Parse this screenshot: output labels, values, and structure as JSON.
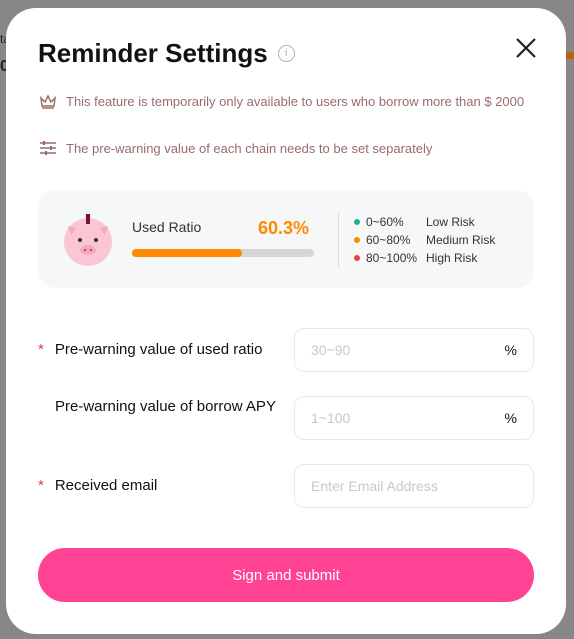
{
  "background": {
    "fragment_1": "ta",
    "fragment_2": "0"
  },
  "modal": {
    "title": "Reminder Settings",
    "notes": [
      {
        "icon": "crown-icon",
        "text": "This feature is temporarily only available to users who borrow more than $ 2000"
      },
      {
        "icon": "sliders-icon",
        "text": "The pre-warning value of each chain needs to be set separately"
      }
    ],
    "ratio_card": {
      "label": "Used Ratio",
      "value": "60.3%",
      "progress_percent": 60.3,
      "legend": [
        {
          "range": "0~60%",
          "label": "Low Risk",
          "color": "#1cb58a"
        },
        {
          "range": "60~80%",
          "label": "Medium Risk",
          "color": "#ff8a00"
        },
        {
          "range": "80~100%",
          "label": "High Risk",
          "color": "#e8453c"
        }
      ]
    },
    "fields": [
      {
        "label": "Pre-warning value of used ratio",
        "required": "*",
        "placeholder": "30~90",
        "unit": "%"
      },
      {
        "label": "Pre-warning value of borrow APY",
        "placeholder": "1~100",
        "unit": "%"
      },
      {
        "label": "Received email",
        "required": "*",
        "placeholder": "Enter Email Address"
      }
    ],
    "submit_label": "Sign and submit",
    "accent": "#ff4294"
  }
}
